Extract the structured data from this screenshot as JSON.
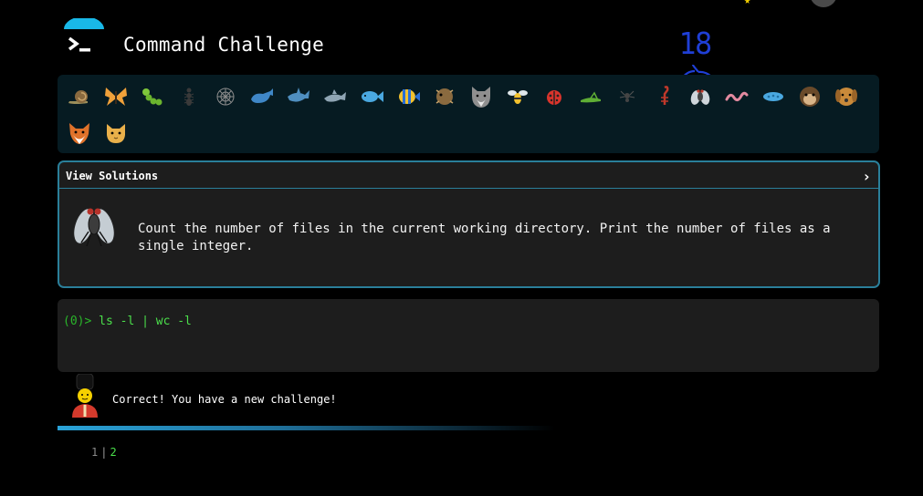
{
  "header": {
    "title": "Command Challenge"
  },
  "annotation": {
    "number": "18"
  },
  "icon_bar": {
    "icons": [
      "snail-icon",
      "butterfly-icon",
      "caterpillar-icon",
      "ant-icon",
      "spider-web-icon",
      "whale-icon",
      "shark-icon",
      "dolphin-icon",
      "fish-icon",
      "tropical-fish-icon",
      "blowfish-icon",
      "wolf-icon",
      "bee-icon",
      "ladybug-icon",
      "cricket-icon",
      "spider-icon",
      "scorpion-icon",
      "fly-icon",
      "worm-icon",
      "microbe-icon",
      "monkey-icon",
      "dog-icon",
      "fox-icon",
      "cat-icon"
    ],
    "selected": "fly-icon"
  },
  "solutions": {
    "label": "View Solutions",
    "chevron": "›"
  },
  "challenge": {
    "text": "Count the number of files in the current working directory. Print the number of files as a single integer."
  },
  "terminal": {
    "prompt_marker": "(0)>",
    "command": "ls -l | wc -l"
  },
  "feedback": {
    "message": "Correct! You have a new challenge!"
  },
  "output": {
    "line_number": "1",
    "value": "2"
  },
  "colors": {
    "accent": "#2a7f9a",
    "prompt_green": "#4be04b",
    "annotation_blue": "#1f3fd6"
  }
}
